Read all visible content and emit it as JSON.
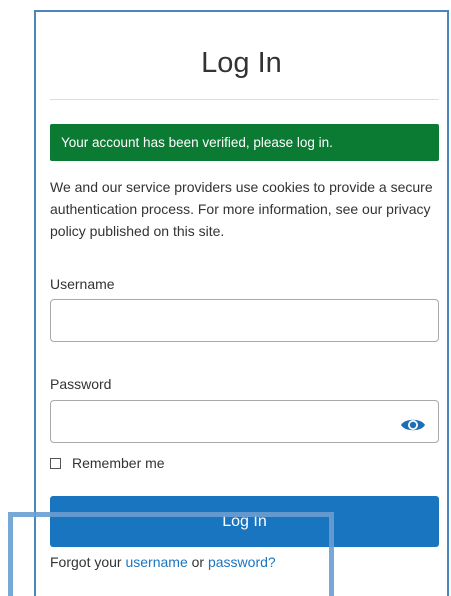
{
  "page": {
    "title": "Log In"
  },
  "alert": {
    "text": "Your account has been verified, please log in.",
    "color": "#0b7a32"
  },
  "info": {
    "text": "We and our service providers use cookies to provide a secure authentication process. For more information, see our privacy policy published on this site."
  },
  "form": {
    "username_label": "Username",
    "username_value": "",
    "password_label": "Password",
    "password_value": "",
    "show_password_icon": "eye-icon",
    "remember_label": "Remember me",
    "remember_checked": false,
    "submit_label": "Log In"
  },
  "forgot": {
    "prefix": "Forgot your ",
    "username_link": "username",
    "middle": " or ",
    "password_link": "password?"
  },
  "colors": {
    "accent": "#1a75c0",
    "frame": "#4a86b8",
    "highlight": "#6a9fd1"
  }
}
